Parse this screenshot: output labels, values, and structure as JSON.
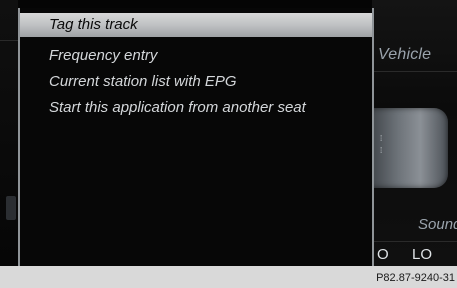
{
  "menu": {
    "items": [
      {
        "label": "Tag this track",
        "selected": true
      },
      {
        "label": "Frequency entry",
        "selected": false
      },
      {
        "label": "Current station list with EPG",
        "selected": false
      },
      {
        "label": "Start this application from another seat",
        "selected": false
      }
    ]
  },
  "background": {
    "vehicle_label": "Vehicle",
    "sound_label": "Sound",
    "left_value": "O",
    "right_value": "LO"
  },
  "footer": {
    "figure_id": "P82.87-9240-31"
  },
  "colors": {
    "screen_bg": "#050505",
    "menu_border": "#8f9498",
    "highlight": "#c8c9cb",
    "menu_text": "#d4d7da"
  }
}
